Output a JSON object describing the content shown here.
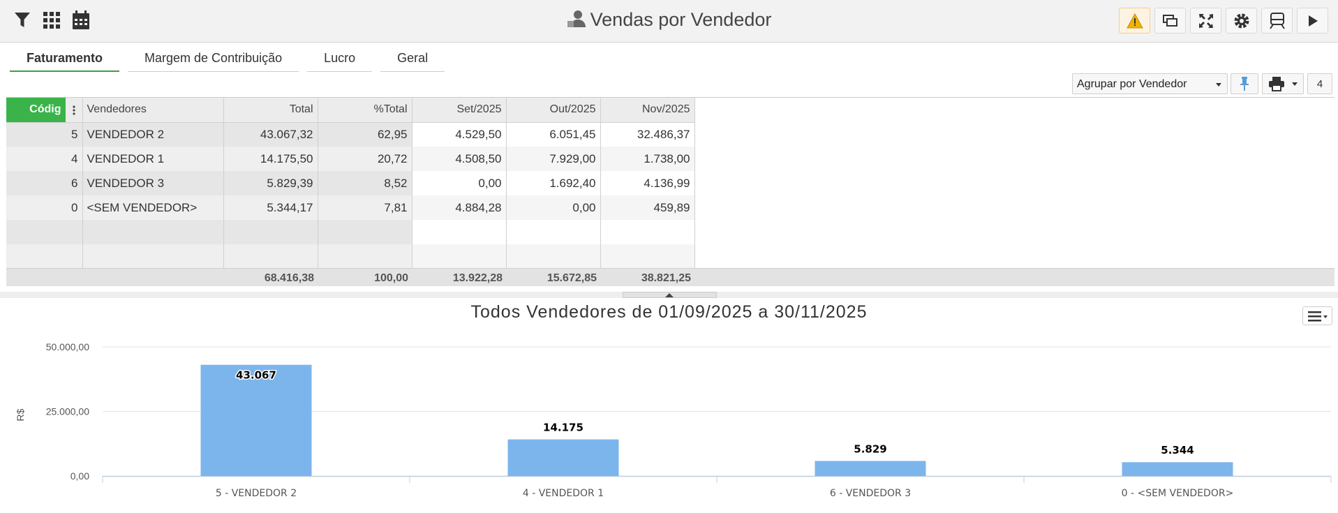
{
  "header": {
    "title": "Vendas por Vendedor",
    "left_icons": [
      "filter-icon",
      "grid-icon",
      "calendar-icon"
    ],
    "right_icons": [
      "warning-icon",
      "windows-icon",
      "fullscreen-icon",
      "gear-icon",
      "train-icon",
      "play-icon"
    ]
  },
  "tabs": [
    {
      "label": "Faturamento",
      "active": true
    },
    {
      "label": "Margem de Contribuição",
      "active": false
    },
    {
      "label": "Lucro",
      "active": false
    },
    {
      "label": "Geral",
      "active": false
    }
  ],
  "toolbar": {
    "group_select": "Agrupar por Vendedor",
    "badge": "4"
  },
  "grid": {
    "columns": [
      "Códig",
      "Vendedores",
      "Total",
      "%Total",
      "Set/2025",
      "Out/2025",
      "Nov/2025"
    ],
    "rows": [
      [
        "5",
        "VENDEDOR 2",
        "43.067,32",
        "62,95",
        "4.529,50",
        "6.051,45",
        "32.486,37"
      ],
      [
        "4",
        "VENDEDOR 1",
        "14.175,50",
        "20,72",
        "4.508,50",
        "7.929,00",
        "1.738,00"
      ],
      [
        "6",
        "VENDEDOR 3",
        "5.829,39",
        "8,52",
        "0,00",
        "1.692,40",
        "4.136,99"
      ],
      [
        "0",
        "<SEM VENDEDOR>",
        "5.344,17",
        "7,81",
        "4.884,28",
        "0,00",
        "459,89"
      ]
    ],
    "totals": [
      "68.416,38",
      "100,00",
      "13.922,28",
      "15.672,85",
      "38.821,25"
    ]
  },
  "chart_data": {
    "type": "bar",
    "title": "Todos Vendedores de 01/09/2025 a 30/11/2025",
    "ylabel": "R$",
    "xlabel": "",
    "categories": [
      "5 - VENDEDOR 2",
      "4 - VENDEDOR 1",
      "6 - VENDEDOR 3",
      "0 - <SEM VENDEDOR>"
    ],
    "values": [
      43067,
      14175,
      5829,
      5344
    ],
    "data_labels": [
      "43.067",
      "14.175",
      "5.829",
      "5.344"
    ],
    "ylim": [
      0,
      50000
    ],
    "yticks": [
      "0,00",
      "25.000,00",
      "50.000,00"
    ],
    "ytick_values": [
      0,
      25000,
      50000
    ],
    "grid": true,
    "legend": "none",
    "bar_color": "#7cb5ec"
  },
  "colors": {
    "accent": "#3ab44a",
    "bar": "#7cb5ec"
  }
}
